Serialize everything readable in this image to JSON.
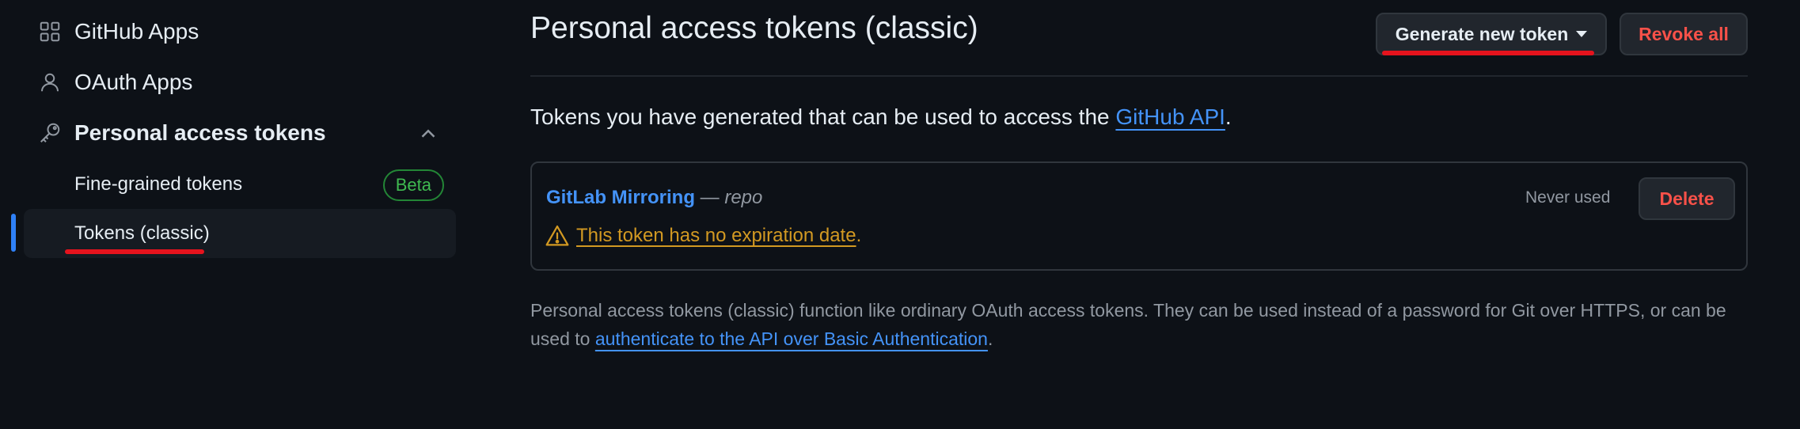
{
  "sidebar": {
    "items": [
      {
        "label": "GitHub Apps",
        "icon": "apps-icon"
      },
      {
        "label": "OAuth Apps",
        "icon": "person-icon"
      },
      {
        "label": "Personal access tokens",
        "icon": "key-icon"
      }
    ],
    "sub_items": [
      {
        "label": "Fine-grained tokens",
        "badge": "Beta"
      },
      {
        "label": "Tokens (classic)"
      }
    ]
  },
  "main": {
    "title": "Personal access tokens (classic)",
    "generate_button": "Generate new token",
    "revoke_button": "Revoke all",
    "intro_text": "Tokens you have generated that can be used to access the ",
    "intro_link": "GitHub API",
    "intro_end": ".",
    "token": {
      "name": "GitLab Mirroring",
      "dash": " — ",
      "scope": "repo",
      "warning": "This token has no expiration date",
      "warning_end": ".",
      "status": "Never used",
      "delete_button": "Delete"
    },
    "footer": {
      "text": "Personal access tokens (classic) function like ordinary OAuth access tokens. They can be used instead of a password for Git over HTTPS, or can be used to ",
      "link": "authenticate to the API over Basic Authentication",
      "end": "."
    }
  },
  "colors": {
    "background": "#0d1117",
    "accent": "#2f81f7",
    "link": "#4493f8",
    "danger": "#f85149",
    "warning": "#d29922",
    "success": "#3fb950",
    "annotation": "#e5131d"
  }
}
